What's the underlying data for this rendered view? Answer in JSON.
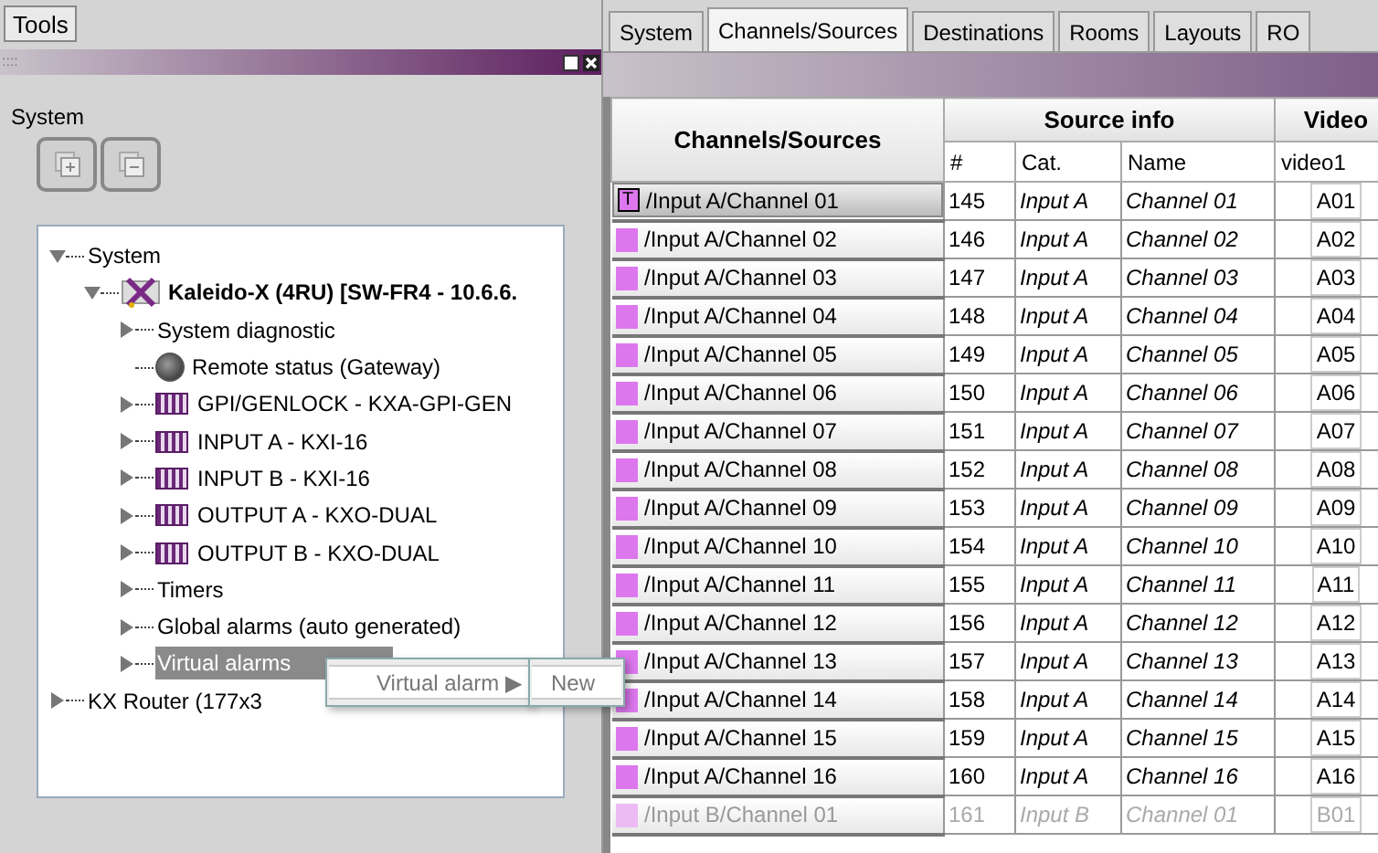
{
  "menu_bar": {
    "label": "Tools"
  },
  "panel": {
    "title_grip": "::::",
    "section_title": "System"
  },
  "tree": [
    {
      "label": "System",
      "expanded": true,
      "selected": false,
      "children": [
        {
          "label": "Kaleido-X (4RU) [SW-FR4 - 10.6.6.",
          "kind": "device",
          "expanded": true,
          "selected": false,
          "children": [
            {
              "label": "System diagnostic",
              "expanded": false,
              "selected": false
            },
            {
              "label": "Remote status (Gateway)",
              "kind": "gauge",
              "selected": false
            },
            {
              "label": "GPI/GENLOCK - KXA-GPI-GEN",
              "kind": "card",
              "expanded": false,
              "selected": false
            },
            {
              "label": "INPUT A - KXI-16",
              "kind": "card",
              "expanded": false,
              "selected": false
            },
            {
              "label": "INPUT B - KXI-16",
              "kind": "card",
              "expanded": false,
              "selected": false
            },
            {
              "label": "OUTPUT A - KXO-DUAL",
              "kind": "card",
              "expanded": false,
              "selected": false
            },
            {
              "label": "OUTPUT B - KXO-DUAL",
              "kind": "card",
              "expanded": false,
              "selected": false
            },
            {
              "label": "Timers",
              "expanded": false,
              "selected": false
            },
            {
              "label": "Global alarms (auto generated)",
              "expanded": false,
              "selected": false
            },
            {
              "label": "Virtual alarms",
              "expanded": false,
              "selected": true
            }
          ]
        }
      ]
    },
    {
      "label": "KX Router (177x3",
      "expanded": false,
      "selected": false
    }
  ],
  "context_menu": [
    {
      "label": "Virtual alarm",
      "arrow": "▶"
    }
  ],
  "submenu": [
    {
      "label": "New"
    }
  ],
  "tabs": [
    {
      "label": "System",
      "selected": false
    },
    {
      "label": "Channels/Sources",
      "selected": true
    },
    {
      "label": "Destinations",
      "selected": false
    },
    {
      "label": "Rooms",
      "selected": false
    },
    {
      "label": "Layouts",
      "selected": false
    },
    {
      "label": "RO",
      "selected": false
    }
  ],
  "table": {
    "main_column": "Channels/Sources",
    "groups": [
      {
        "label": "Source info",
        "columns": [
          "#",
          "Cat.",
          "Name"
        ]
      },
      {
        "label": "Video",
        "columns": [
          "video1"
        ]
      }
    ],
    "rows": [
      {
        "source": "/Input A/Channel 01",
        "tag": "T",
        "color": "#dd77ee",
        "selected": true,
        "cells": [
          "145",
          "Input A",
          "Channel 01",
          "A01"
        ]
      },
      {
        "source": "/Input A/Channel 02",
        "color": "#dd77ee",
        "selected": false,
        "cells": [
          "146",
          "Input A",
          "Channel 02",
          "A02"
        ]
      },
      {
        "source": "/Input A/Channel 03",
        "color": "#dd77ee",
        "selected": false,
        "cells": [
          "147",
          "Input A",
          "Channel 03",
          "A03"
        ]
      },
      {
        "source": "/Input A/Channel 04",
        "color": "#dd77ee",
        "selected": false,
        "cells": [
          "148",
          "Input A",
          "Channel 04",
          "A04"
        ]
      },
      {
        "source": "/Input A/Channel 05",
        "color": "#dd77ee",
        "selected": false,
        "cells": [
          "149",
          "Input A",
          "Channel 05",
          "A05"
        ]
      },
      {
        "source": "/Input A/Channel 06",
        "color": "#dd77ee",
        "selected": false,
        "cells": [
          "150",
          "Input A",
          "Channel 06",
          "A06"
        ]
      },
      {
        "source": "/Input A/Channel 07",
        "color": "#dd77ee",
        "selected": false,
        "cells": [
          "151",
          "Input A",
          "Channel 07",
          "A07"
        ]
      },
      {
        "source": "/Input A/Channel 08",
        "color": "#dd77ee",
        "selected": false,
        "cells": [
          "152",
          "Input A",
          "Channel 08",
          "A08"
        ]
      },
      {
        "source": "/Input A/Channel 09",
        "color": "#dd77ee",
        "selected": false,
        "cells": [
          "153",
          "Input A",
          "Channel 09",
          "A09"
        ]
      },
      {
        "source": "/Input A/Channel 10",
        "color": "#dd77ee",
        "selected": false,
        "cells": [
          "154",
          "Input A",
          "Channel 10",
          "A10"
        ]
      },
      {
        "source": "/Input A/Channel 11",
        "color": "#dd77ee",
        "selected": false,
        "cells": [
          "155",
          "Input A",
          "Channel 11",
          "A11"
        ]
      },
      {
        "source": "/Input A/Channel 12",
        "color": "#dd77ee",
        "selected": false,
        "cells": [
          "156",
          "Input A",
          "Channel 12",
          "A12"
        ]
      },
      {
        "source": "/Input A/Channel 13",
        "color": "#dd77ee",
        "selected": false,
        "cells": [
          "157",
          "Input A",
          "Channel 13",
          "A13"
        ]
      },
      {
        "source": "/Input A/Channel 14",
        "color": "#dd77ee",
        "selected": false,
        "cells": [
          "158",
          "Input A",
          "Channel 14",
          "A14"
        ]
      },
      {
        "source": "/Input A/Channel 15",
        "color": "#dd77ee",
        "selected": false,
        "cells": [
          "159",
          "Input A",
          "Channel 15",
          "A15"
        ]
      },
      {
        "source": "/Input A/Channel 16",
        "color": "#dd77ee",
        "selected": false,
        "cells": [
          "160",
          "Input A",
          "Channel 16",
          "A16"
        ]
      },
      {
        "source": "/Input B/Channel 01",
        "color": "#ecbbf4",
        "selected": false,
        "cells": [
          "161",
          "Input B",
          "Channel 01",
          "B01"
        ]
      }
    ]
  }
}
